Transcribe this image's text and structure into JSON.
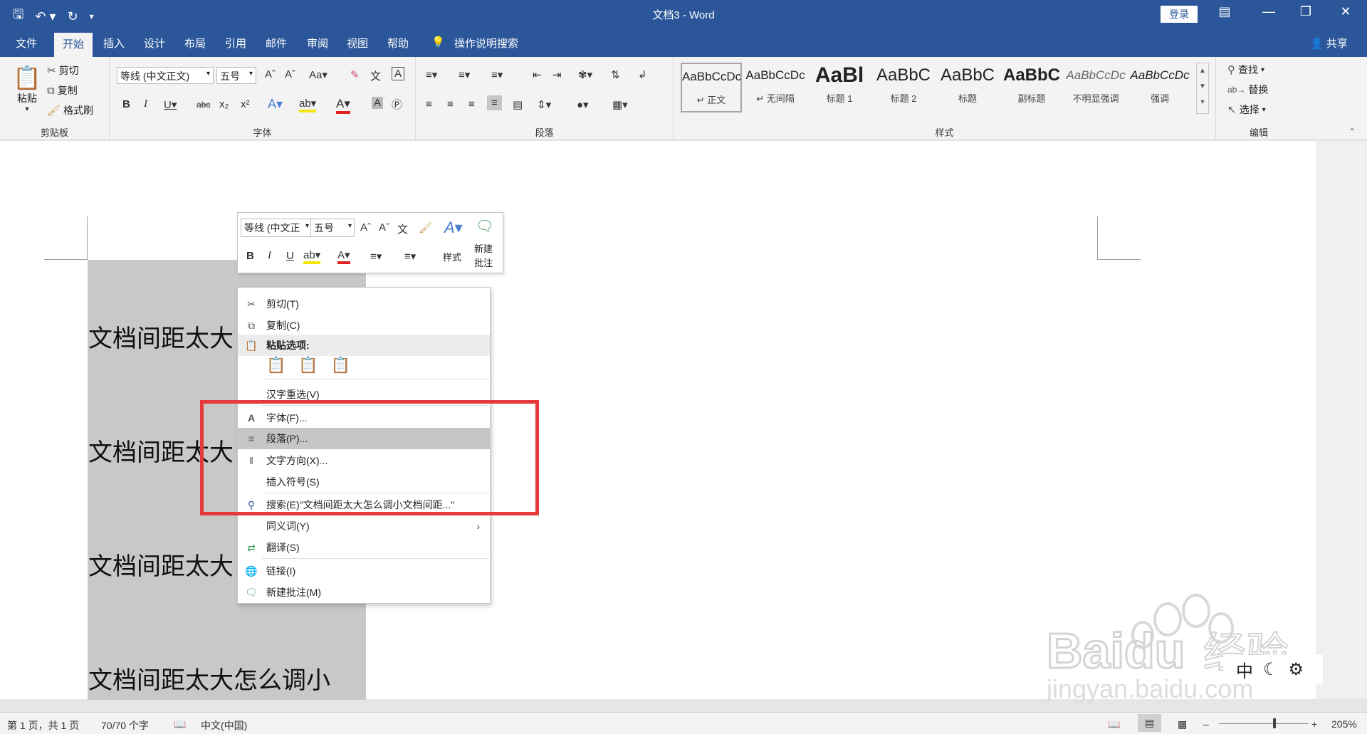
{
  "titlebar": {
    "doc_title": "文档3 - Word",
    "login": "登录"
  },
  "tabs": [
    {
      "label": "文件"
    },
    {
      "label": "开始",
      "active": true
    },
    {
      "label": "插入"
    },
    {
      "label": "设计"
    },
    {
      "label": "布局"
    },
    {
      "label": "引用"
    },
    {
      "label": "邮件"
    },
    {
      "label": "审阅"
    },
    {
      "label": "视图"
    },
    {
      "label": "帮助"
    }
  ],
  "tell_me": "操作说明搜索",
  "share": "共享",
  "clipboard": {
    "paste": "粘贴",
    "cut": "剪切",
    "copy": "复制",
    "format_painter": "格式刷",
    "group_label": "剪贴板"
  },
  "font": {
    "font_name": "等线 (中文正文)",
    "font_size": "五号",
    "group_label": "字体"
  },
  "paragraph": {
    "group_label": "段落"
  },
  "styles": {
    "items": [
      {
        "sample": "AaBbCcDc",
        "name": "↵ 正文"
      },
      {
        "sample": "AaBbCcDc",
        "name": "↵ 无间隔"
      },
      {
        "sample": "AaBl",
        "name": "标题 1"
      },
      {
        "sample": "AaBbC",
        "name": "标题 2"
      },
      {
        "sample": "AaBbC",
        "name": "标题"
      },
      {
        "sample": "AaBbC",
        "name": "副标题"
      },
      {
        "sample": "AaBbCcDc",
        "name": "不明显强调"
      },
      {
        "sample": "AaBbCcDc",
        "name": "强调"
      }
    ],
    "group_label": "样式"
  },
  "editing": {
    "find": "查找",
    "replace": "替换",
    "select": "选择",
    "group_label": "编辑"
  },
  "document": {
    "lines": [
      "文档间距太大",
      "文档间距太大",
      "文档间距太大",
      "文档间距太大怎么调小"
    ]
  },
  "minibar": {
    "font_name": "等线 (中文正",
    "font_size": "五号",
    "styles_label": "样式",
    "new_comment_1": "新建",
    "new_comment_2": "批注"
  },
  "context_menu": {
    "cut": "剪切(T)",
    "copy": "复制(C)",
    "paste_options": "粘贴选项:",
    "hanzi_reselect": "汉字重选(V)",
    "font": "字体(F)...",
    "paragraph": "段落(P)...",
    "text_direction": "文字方向(X)...",
    "insert_symbol": "插入符号(S)",
    "search": "搜索(E)\"文档间距太大怎么调小文档间距...\"",
    "synonyms": "同义词(Y)",
    "translate": "翻译(S)",
    "link": "链接(I)",
    "new_comment": "新建批注(M)"
  },
  "statusbar": {
    "page": "第 1 页，共 1 页",
    "words": "70/70 个字",
    "language": "中文(中国)",
    "zoom": "205%"
  },
  "ime": {
    "mode": "中"
  },
  "watermark": {
    "brand": "Bai",
    "brand2": "du",
    "cn": "经验",
    "url": "jingyan.baidu.com"
  },
  "colors": {
    "word_blue": "#2b579a",
    "red_box": "#e83a3a",
    "selection": "#c8c8c8"
  }
}
